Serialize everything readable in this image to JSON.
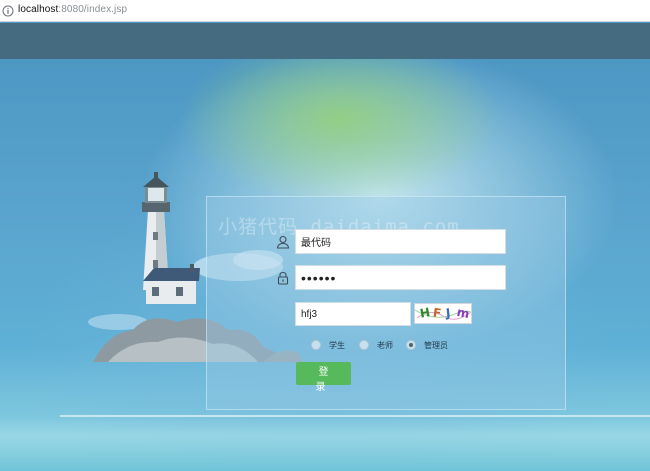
{
  "browser": {
    "url_host": "localhost",
    "url_rest": ":8080/index.jsp",
    "info_icon": "info-icon"
  },
  "watermark": "小猪代码 daidaima.com",
  "login": {
    "username_value": "最代码",
    "password_value": "••••••",
    "captcha_value": "hfj3",
    "captcha_image_text": [
      "H",
      "F",
      "J",
      "m"
    ],
    "roles": [
      "学生",
      "老师",
      "管理员"
    ],
    "selected_role": "管理员",
    "submit_label": "登 录",
    "user_icon": "user-icon",
    "lock_icon": "lock-icon"
  },
  "colors": {
    "banner": "#456b81",
    "button": "#56b95c",
    "sky": "#4d97c4"
  }
}
